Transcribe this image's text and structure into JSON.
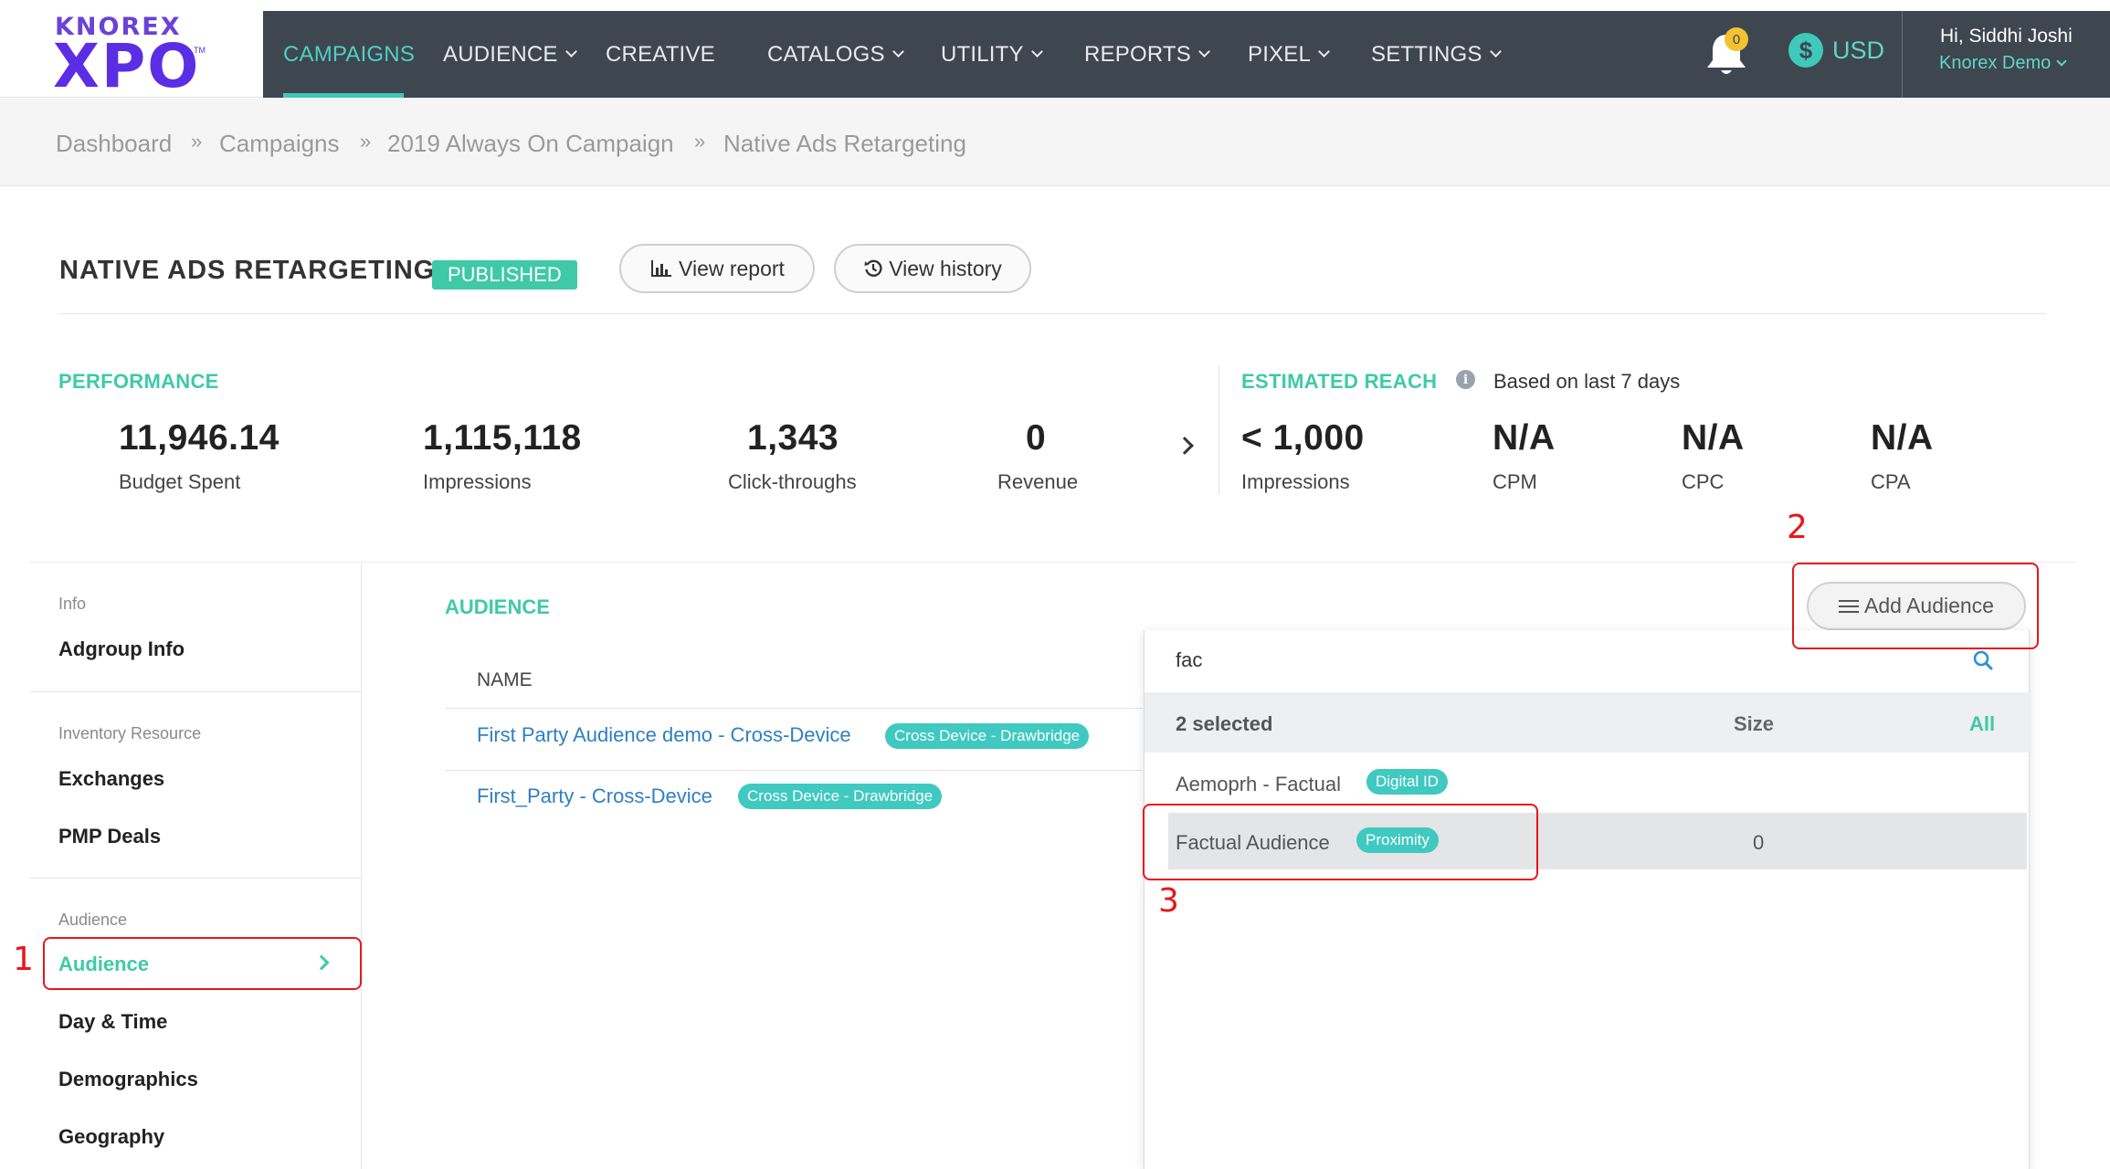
{
  "brand": {
    "top": "KNOREX",
    "main": "XPO",
    "tm": "TM"
  },
  "nav": {
    "items": [
      {
        "label": "CAMPAIGNS",
        "dropdown": false,
        "active": true
      },
      {
        "label": "AUDIENCE",
        "dropdown": true
      },
      {
        "label": "CREATIVE",
        "dropdown": false
      },
      {
        "label": "CATALOGS",
        "dropdown": true
      },
      {
        "label": "UTILITY",
        "dropdown": true
      },
      {
        "label": "REPORTS",
        "dropdown": true
      },
      {
        "label": "PIXEL",
        "dropdown": true
      },
      {
        "label": "SETTINGS",
        "dropdown": true
      }
    ],
    "notifications_count": "0",
    "currency_symbol": "$",
    "currency": "USD",
    "greeting": "Hi, Siddhi Joshi",
    "account": "Knorex Demo"
  },
  "breadcrumb": [
    "Dashboard",
    "Campaigns",
    "2019 Always On Campaign",
    "Native Ads Retargeting"
  ],
  "breadcrumb_sep": "»",
  "title": "NATIVE ADS RETARGETING",
  "status": "PUBLISHED",
  "buttons": {
    "view_report": "View report",
    "view_history": "View history",
    "add_audience": "Add Audience"
  },
  "performance": {
    "label": "PERFORMANCE",
    "metrics": [
      {
        "value": "11,946.14",
        "label": "Budget Spent"
      },
      {
        "value": "1,115,118",
        "label": "Impressions"
      },
      {
        "value": "1,343",
        "label": "Click-throughs"
      },
      {
        "value": "0",
        "label": "Revenue"
      }
    ]
  },
  "reach": {
    "label": "ESTIMATED REACH",
    "info_glyph": "i",
    "note": "Based on last 7 days",
    "metrics": [
      {
        "value": "< 1,000",
        "label": "Impressions"
      },
      {
        "value": "N/A",
        "label": "CPM"
      },
      {
        "value": "N/A",
        "label": "CPC"
      },
      {
        "value": "N/A",
        "label": "CPA"
      }
    ]
  },
  "sidebar": {
    "groups": [
      {
        "label": "Info",
        "items": [
          "Adgroup Info"
        ]
      },
      {
        "label": "Inventory Resource",
        "items": [
          "Exchanges",
          "PMP Deals"
        ]
      },
      {
        "label": "Audience",
        "items": [
          "Audience",
          "Day & Time",
          "Demographics",
          "Geography"
        ]
      }
    ],
    "active_item": "Audience"
  },
  "audience": {
    "heading": "AUDIENCE",
    "column_name": "NAME",
    "rows": [
      {
        "name": "First Party Audience demo - Cross-Device",
        "tag": "Cross Device - Drawbridge"
      },
      {
        "name": "First_Party - Cross-Device",
        "tag": "Cross Device - Drawbridge"
      }
    ]
  },
  "dropdown": {
    "search_value": "fac",
    "selected_count": "2 selected",
    "size_header": "Size",
    "all_label": "All",
    "options": [
      {
        "name": "Aemoprh - Factual",
        "tag": "Digital ID",
        "size": ""
      },
      {
        "name": "Factual Audience",
        "tag": "Proximity",
        "size": "0"
      }
    ]
  },
  "annotations": [
    "1",
    "2",
    "3"
  ],
  "colors": {
    "accent": "#3fc9a7",
    "nav_bg": "#3e4650",
    "link": "#2f7fc1",
    "annotation": "#e8161b",
    "brand": "#5b2ee6"
  }
}
